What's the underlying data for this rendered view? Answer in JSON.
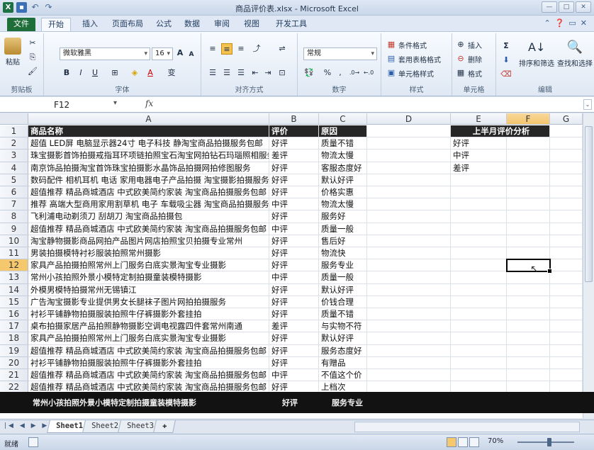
{
  "window": {
    "title": "商品评价表.xlsx - Microsoft Excel"
  },
  "tabs": [
    {
      "label": "文件"
    },
    {
      "label": "开始"
    },
    {
      "label": "插入"
    },
    {
      "label": "页面布局"
    },
    {
      "label": "公式"
    },
    {
      "label": "数据"
    },
    {
      "label": "审阅"
    },
    {
      "label": "视图"
    },
    {
      "label": "开发工具"
    }
  ],
  "ribbon": {
    "clipboard": {
      "label": "剪贴板",
      "paste": "粘贴"
    },
    "font": {
      "label": "字体",
      "name": "微软雅黑",
      "size": "16",
      "bold": "B",
      "italic": "I",
      "underline": "U",
      "grow": "A",
      "shrink": "A",
      "phonetic": "变"
    },
    "alignment": {
      "label": "对齐方式"
    },
    "number": {
      "label": "数字",
      "format": "常规",
      "percent": "%",
      "comma": ","
    },
    "styles": {
      "label": "样式",
      "conditional": "条件格式",
      "table": "套用表格格式",
      "cell": "单元格样式"
    },
    "cells": {
      "label": "单元格",
      "insert": "插入",
      "delete": "删除",
      "format": "格式"
    },
    "editing": {
      "label": "编辑",
      "sum": "Σ",
      "sort": "排序和筛选",
      "find": "查找和选择"
    }
  },
  "formula_bar": {
    "name_box": "F12",
    "fx": "fx",
    "value": ""
  },
  "grid": {
    "columns": [
      "A",
      "B",
      "C",
      "D",
      "E",
      "F",
      "G"
    ],
    "selected_cell": "F12",
    "rows": [
      {
        "n": "1",
        "a": "商品名称",
        "b": "评价",
        "c": "原因",
        "e": "上半月评价分析",
        "header": true
      },
      {
        "n": "2",
        "a": "超值 LED屏 电脑显示器24寸 电子科技 静淘宝商品拍摄服务包邮",
        "b": "好评",
        "c": "质量不错",
        "e": "好评"
      },
      {
        "n": "3",
        "a": "珠宝摄影首饰拍摄戒指耳环项链拍照宝石淘宝网拍钻石玛瑙照相服务",
        "b": "差评",
        "c": "物流太慢",
        "e": "中评"
      },
      {
        "n": "4",
        "a": "南京饰品拍摄淘宝首饰珠宝拍摄影水晶饰品拍摄网拍修图服务",
        "b": "好评",
        "c": "客服态度好",
        "e": "差评"
      },
      {
        "n": "5",
        "a": "数码配件 相机耳机 电话 家用电器电子产品拍摄 淘宝摄影拍摄服务",
        "b": "好评",
        "c": "默认好评"
      },
      {
        "n": "6",
        "a": "超值推荐 精品商城酒店 中式欧美简约家装 淘宝商品拍摄服务包邮",
        "b": "好评",
        "c": "价格实惠"
      },
      {
        "n": "7",
        "a": "推荐 高端大型商用家用割草机 电子 车载吸尘器 淘宝商品拍摄服务",
        "b": "中评",
        "c": "物流太慢"
      },
      {
        "n": "8",
        "a": "飞利浦电动剃须刀 刮胡刀 淘宝商品拍摄包",
        "b": "好评",
        "c": "服务好"
      },
      {
        "n": "9",
        "a": "超值推荐 精品商城酒店 中式欧美简约家装 淘宝商品拍摄服务包邮",
        "b": "中评",
        "c": "质量一般"
      },
      {
        "n": "10",
        "a": "淘宝静物摄影商品网拍产品图片网店拍照宝贝拍摄专业常州",
        "b": "好评",
        "c": "售后好"
      },
      {
        "n": "11",
        "a": "男装拍摄模特衬衫服装拍照常州摄影",
        "b": "好评",
        "c": "物流快"
      },
      {
        "n": "12",
        "a": "家具产品拍摄拍照常州上门服务白底实景淘宝专业摄影",
        "b": "好评",
        "c": "服务专业"
      },
      {
        "n": "13",
        "a": "常州小孩拍照外景小模特定制拍摄童装模特摄影",
        "b": "中评",
        "c": "质量一般"
      },
      {
        "n": "14",
        "a": "外模男模特拍摄常州无锡镇江",
        "b": "好评",
        "c": "默认好评"
      },
      {
        "n": "15",
        "a": "广告淘宝摄影专业提供男女长腿袜子图片网拍拍摄服务",
        "b": "好评",
        "c": "价钱合理"
      },
      {
        "n": "16",
        "a": "衬衫平铺静物拍摄服装拍照牛仔裤摄影外套挂拍",
        "b": "好评",
        "c": "质量不错"
      },
      {
        "n": "17",
        "a": "桌布拍摄家居产品拍照静物摄影空调电视露四件套常州南通",
        "b": "差评",
        "c": "与实物不符"
      },
      {
        "n": "18",
        "a": "家具产品拍摄拍照常州上门服务白底实景淘宝专业摄影",
        "b": "好评",
        "c": "默认好评"
      },
      {
        "n": "19",
        "a": "超值推荐 精品商城酒店 中式欧美简约家装 淘宝商品拍摄服务包邮",
        "b": "好评",
        "c": "服务态度好"
      },
      {
        "n": "20",
        "a": "衬衫平铺静物拍摄服装拍照牛仔裤摄影外套挂拍",
        "b": "好评",
        "c": "有赠品"
      },
      {
        "n": "21",
        "a": "超值推荐 精品商城酒店 中式欧美简约家装 淘宝商品拍摄服务包邮",
        "b": "中评",
        "c": "不值这个价"
      },
      {
        "n": "22",
        "a": "超值推荐 精品商城酒店 中式欧美简约家装 淘宝商品拍摄服务包邮",
        "b": "好评",
        "c": "上档次"
      }
    ],
    "glitch_row": {
      "a": "常州小孩拍照外景小模特定制拍摄童装模特摄影",
      "b": "好评",
      "c": "服务专业"
    }
  },
  "sheets": [
    {
      "label": "Sheet1",
      "active": true
    },
    {
      "label": "Sheet2"
    },
    {
      "label": "Sheet3"
    }
  ],
  "status": {
    "ready": "就绪",
    "zoom": "70%"
  },
  "colors": {
    "header_fill": "#262626",
    "selected_header": "#f6c86e",
    "file_tab": "#1f6e3a"
  }
}
